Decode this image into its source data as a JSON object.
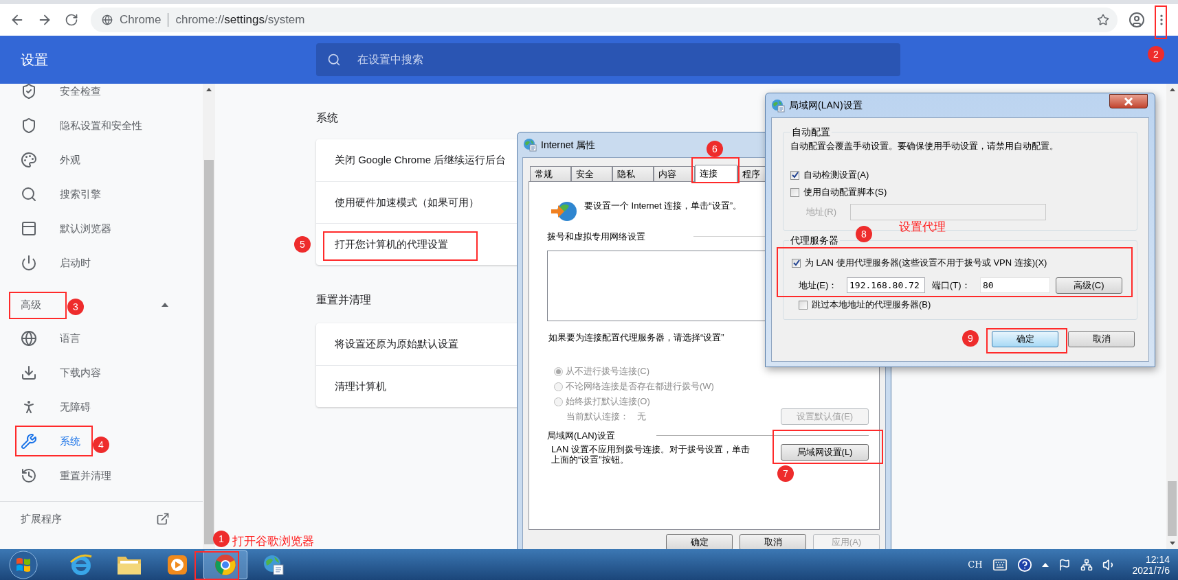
{
  "browser": {
    "address": {
      "site": "Chrome",
      "url": "chrome://**settings**/system"
    }
  },
  "settings": {
    "title": "设置",
    "search_placeholder": "在设置中搜索",
    "sidebar": {
      "items": [
        {
          "label": "安全检查",
          "selected": false
        },
        {
          "label": "隐私设置和安全性",
          "selected": false
        },
        {
          "label": "外观",
          "selected": false
        },
        {
          "label": "搜索引擎",
          "selected": false
        },
        {
          "label": "默认浏览器",
          "selected": false
        },
        {
          "label": "启动时",
          "selected": false
        }
      ],
      "advanced": {
        "label": "高级",
        "expanded": true
      },
      "advanced_items": [
        {
          "label": "语言",
          "selected": false
        },
        {
          "label": "下载内容",
          "selected": false
        },
        {
          "label": "无障碍",
          "selected": false
        },
        {
          "label": "系统",
          "selected": true
        },
        {
          "label": "重置并清理",
          "selected": false
        }
      ],
      "extensions": "扩展程序"
    },
    "sections": [
      {
        "title": "系统",
        "rows": [
          "关闭 Google Chrome 后继续运行后台",
          "使用硬件加速模式（如果可用）",
          "打开您计算机的代理设置"
        ]
      },
      {
        "title": "重置并清理",
        "rows": [
          "将设置还原为原始默认设置",
          "清理计算机"
        ]
      }
    ]
  },
  "internet_properties": {
    "title": "Internet 属性",
    "tabs": [
      {
        "label": "常规",
        "selected": false
      },
      {
        "label": "安全",
        "selected": false
      },
      {
        "label": "隐私",
        "selected": false
      },
      {
        "label": "内容",
        "selected": false
      },
      {
        "label": "连接",
        "selected": true
      },
      {
        "label": "程序",
        "selected": false
      }
    ],
    "intro": "要设置一个 Internet 连接，单击“设置”。",
    "dialup_heading": "拨号和虚拟专用网络设置",
    "proxy_hint": "如果要为连接配置代理服务器，请选择“设置”",
    "dial_options": [
      {
        "label": "从不进行拨号连接(C)",
        "selected": true,
        "disabled": true
      },
      {
        "label": "不论网络连接是否存在都进行拨号(W)",
        "selected": false,
        "disabled": true
      },
      {
        "label": "始终拨打默认连接(O)",
        "selected": false,
        "disabled": true
      }
    ],
    "default_connection": {
      "label": "当前默认连接：",
      "value": "无"
    },
    "set_default_button": {
      "label": "设置默认值(E)",
      "disabled": true
    },
    "lan_heading": "局域网(LAN)设置",
    "lan_note": "LAN 设置不应用到拨号连接。对于拨号设置，单击上面的“设置”按钮。",
    "lan_button": "局域网设置(L)",
    "buttons": [
      {
        "label": "确定",
        "disabled": false
      },
      {
        "label": "取消",
        "disabled": false
      },
      {
        "label": "应用(A)",
        "disabled": true
      }
    ]
  },
  "lan_settings": {
    "title": "局域网(LAN)设置",
    "auto_config": {
      "legend": "自动配置",
      "description": "自动配置会覆盖手动设置。要确保使用手动设置，请禁用自动配置。",
      "options": [
        {
          "label": "自动检测设置(A)",
          "checked": true
        },
        {
          "label": "使用自动配置脚本(S)",
          "checked": false
        }
      ],
      "script_address": {
        "label": "地址(R)",
        "disabled": true
      }
    },
    "proxy": {
      "legend": "代理服务器",
      "use_proxy": {
        "label": "为 LAN 使用代理服务器(这些设置不用于拨号或 VPN 连接)(X)",
        "checked": true
      },
      "address": {
        "label": "地址(E)：",
        "value": "192.168.80.72"
      },
      "port": {
        "label": "端口(T)：",
        "value": "80"
      },
      "advanced_button": "高级(C)",
      "bypass_local": {
        "label": "跳过本地地址的代理服务器(B)",
        "checked": false
      }
    },
    "buttons": [
      {
        "label": "确定",
        "selected": true
      },
      {
        "label": "取消",
        "selected": false
      }
    ]
  },
  "taskbar": {
    "apps": [
      {
        "kind": "globe",
        "selected": false
      },
      {
        "kind": "folder",
        "selected": false
      },
      {
        "kind": "player",
        "selected": false
      },
      {
        "kind": "browser",
        "selected": true
      },
      {
        "kind": "options",
        "selected": false
      }
    ],
    "tray": {
      "language": "CH",
      "time": "12:14",
      "date": "2021/7/6"
    }
  },
  "annotations": {
    "steps": [
      "1",
      "2",
      "3",
      "4",
      "5",
      "6",
      "7",
      "8",
      "9"
    ],
    "notes": [
      "打开谷歌浏览器",
      "设置代理"
    ]
  }
}
